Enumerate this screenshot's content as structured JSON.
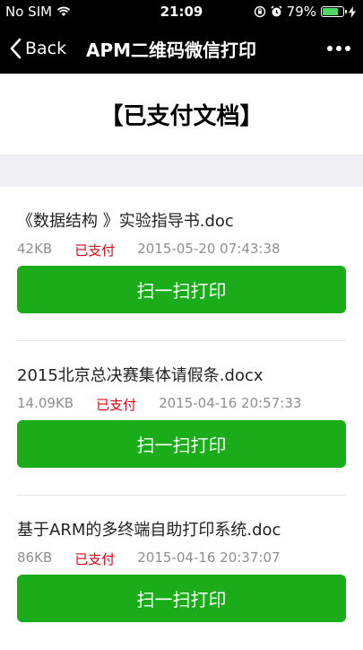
{
  "status_bar": {
    "carrier": "No SIM",
    "time": "21:09",
    "battery_percent_text": "79%",
    "battery_level": 0.79
  },
  "nav": {
    "back_label": "Back",
    "title": "APM二维码微信打印"
  },
  "page": {
    "title": "【已支付文档】"
  },
  "documents": [
    {
      "name": "《数据结构 》实验指导书.doc",
      "size": "42KB",
      "status": "已支付",
      "timestamp": "2015-05-20 07:43:38",
      "button_label": "扫一扫打印"
    },
    {
      "name": "2015北京总决赛集体请假条.docx",
      "size": "14.09KB",
      "status": "已支付",
      "timestamp": "2015-04-16 20:57:33",
      "button_label": "扫一扫打印"
    },
    {
      "name": "基于ARM的多终端自助打印系统.doc",
      "size": "86KB",
      "status": "已支付",
      "timestamp": "2015-04-16 20:37:07",
      "button_label": "扫一扫打印"
    }
  ],
  "colors": {
    "accent_green": "#1aad19",
    "paid_red": "#e60012",
    "nav_background": "#000000"
  }
}
